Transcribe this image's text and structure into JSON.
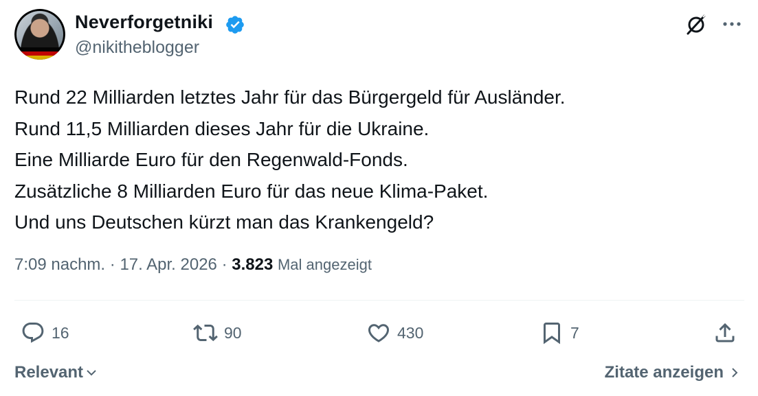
{
  "author": {
    "display_name": "Neverforgetniki",
    "handle": "@nikitheblogger",
    "verified_color": "#1d9bf0"
  },
  "tweet": {
    "lines": [
      "Rund 22 Milliarden letztes Jahr für das Bürgergeld für Ausländer.",
      "Rund 11,5 Milliarden dieses Jahr für die Ukraine.",
      "Eine Milliarde Euro für den Regenwald-Fonds.",
      "Zusätzliche 8 Milliarden Euro für das neue Klima-Paket.",
      "Und uns Deutschen kürzt man das Krankengeld?"
    ],
    "time": "7:09 nachm.",
    "separator": "·",
    "date": "17. Apr. 2026",
    "views_count": "3.823",
    "views_label": "Mal angezeigt"
  },
  "actions": {
    "replies": "16",
    "reposts": "90",
    "likes": "430",
    "bookmarks": "7"
  },
  "footer": {
    "sort_label": "Relevant",
    "quotes_label": "Zitate anzeigen"
  },
  "icons": {
    "avatar": "avatar-image",
    "verified": "verified-badge-icon",
    "grok": "grok-icon",
    "more": "more-icon",
    "reply": "reply-icon",
    "repost": "repost-icon",
    "like": "like-icon",
    "bookmark": "bookmark-icon",
    "share": "share-icon",
    "chevron_down": "chevron-down-icon",
    "chevron_right": "chevron-right-icon"
  }
}
